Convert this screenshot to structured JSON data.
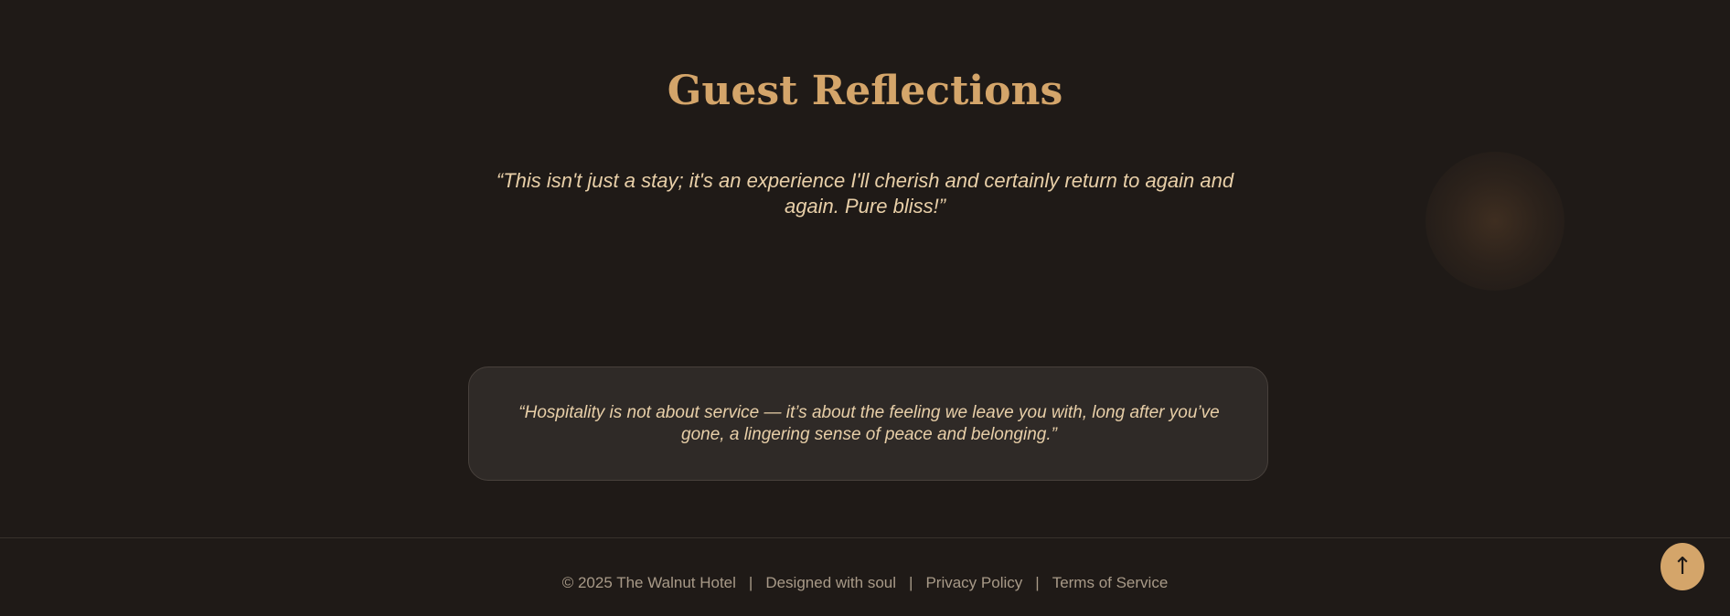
{
  "reflections": {
    "title": "Guest Reflections",
    "testimonial": "“This isn't just a stay; it's an experience I'll cherish and certainly return to again and again. Pure bliss!”"
  },
  "quote_card": {
    "text": "“Hospitality is not about service — it’s about the feeling we leave you with, long after you’ve gone, a lingering sense of peace and belonging.”"
  },
  "footer": {
    "copyright": "© 2025 The Walnut Hotel",
    "separator": "|",
    "tagline": "Designed with soul",
    "privacy_label": "Privacy Policy",
    "terms_label": "Terms of Service"
  },
  "back_to_top": {
    "icon_name": "arrow-up-icon",
    "glyph": "↑"
  },
  "colors": {
    "background": "#1f1a17",
    "accent": "#d4a56a",
    "quote_text": "#e8cfa8",
    "card_background": "#2f2a27",
    "footer_text": "#a89a88"
  }
}
